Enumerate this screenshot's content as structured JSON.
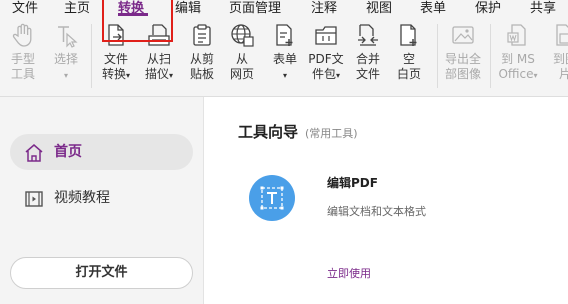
{
  "menu": {
    "items": [
      "文件",
      "主页",
      "转换",
      "编辑",
      "页面管理",
      "注释",
      "视图",
      "表单",
      "保护",
      "共享"
    ],
    "active": "转换"
  },
  "ribbon": {
    "tools": [
      {
        "line1": "手型",
        "line2": "工具",
        "icon": "hand-icon",
        "disabled": true,
        "caret": false
      },
      {
        "line1": "选择",
        "line2": "",
        "icon": "select-text-icon",
        "disabled": true,
        "caret": true
      },
      {
        "line1": "文件",
        "line2": "转换",
        "icon": "file-convert-icon",
        "disabled": false,
        "caret": true
      },
      {
        "line1": "从扫",
        "line2": "描仪",
        "icon": "scanner-icon",
        "disabled": false,
        "caret": true
      },
      {
        "line1": "从剪",
        "line2": "贴板",
        "icon": "clipboard-icon",
        "disabled": false,
        "caret": false
      },
      {
        "line1": "从",
        "line2": "网页",
        "icon": "globe-icon",
        "disabled": false,
        "caret": false
      },
      {
        "line1": "表单",
        "line2": "",
        "icon": "form-icon",
        "disabled": false,
        "caret": true
      },
      {
        "line1": "PDF文",
        "line2": "件包",
        "icon": "portfolio-icon",
        "disabled": false,
        "caret": true
      },
      {
        "line1": "合并",
        "line2": "文件",
        "icon": "merge-files-icon",
        "disabled": false,
        "caret": false
      },
      {
        "line1": "空",
        "line2": "白页",
        "icon": "blank-page-icon",
        "disabled": false,
        "caret": false
      },
      {
        "line1": "导出全",
        "line2": "部图像",
        "icon": "export-images-icon",
        "disabled": true,
        "caret": false
      },
      {
        "line1": "到 MS",
        "line2": "Office",
        "icon": "to-office-icon",
        "disabled": true,
        "caret": true
      },
      {
        "line1": "到图",
        "line2": "片",
        "icon": "to-image-icon",
        "disabled": true,
        "caret": false
      }
    ]
  },
  "sidebar": {
    "items": [
      {
        "label": "首页",
        "icon": "home-icon",
        "active": true
      },
      {
        "label": "视频教程",
        "icon": "video-icon",
        "active": false
      }
    ],
    "open_button": "打开文件"
  },
  "main": {
    "title": "工具向导",
    "subtitle": "(常用工具)",
    "card": {
      "icon": "edit-text-icon",
      "title": "编辑PDF",
      "description": "编辑文档和文本格式",
      "link": "立即使用"
    }
  },
  "colors": {
    "accent": "#7b2a8a",
    "highlight_box": "#e0201a",
    "card_icon_bg": "#4a9fe8"
  }
}
